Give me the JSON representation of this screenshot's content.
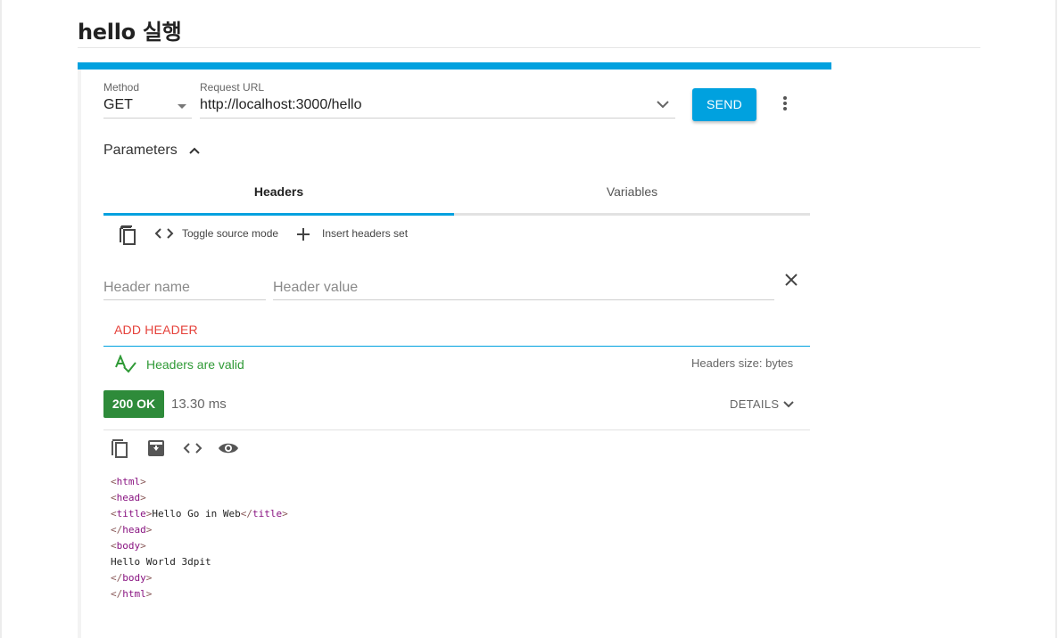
{
  "page": {
    "title": "hello 실행"
  },
  "request": {
    "method_label": "Method",
    "method_value": "GET",
    "url_label": "Request URL",
    "url_value": "http://localhost:3000/hello",
    "send_label": "SEND"
  },
  "parameters": {
    "label": "Parameters",
    "tabs": [
      {
        "label": "Headers",
        "active": true
      },
      {
        "label": "Variables",
        "active": false
      }
    ],
    "toolbar": {
      "toggle_source_label": "Toggle source mode",
      "insert_set_label": "Insert headers set"
    },
    "header_row": {
      "name_placeholder": "Header name",
      "value_placeholder": "Header value"
    },
    "add_header_label": "ADD HEADER",
    "validation": {
      "valid_text": "Headers are valid",
      "size_text": "Headers size: bytes"
    }
  },
  "response": {
    "status": "200 OK",
    "time": "13.30 ms",
    "details_label": "DETAILS",
    "status_color": "#2e8b3a",
    "body_lines": [
      {
        "open": "<",
        "tag": "html",
        "close": ">",
        "text": ""
      },
      {
        "open": "<",
        "tag": "head",
        "close": ">",
        "text": ""
      },
      {
        "open": "<",
        "tag": "title",
        "close": ">",
        "text": "Hello Go in Web",
        "end_open": "</",
        "end_tag": "title",
        "end_close": ">"
      },
      {
        "open": "</",
        "tag": "head",
        "close": ">",
        "text": ""
      },
      {
        "open": "<",
        "tag": "body",
        "close": ">",
        "text": ""
      },
      {
        "open": "",
        "tag": "",
        "close": "",
        "text": "Hello World 3dpit"
      },
      {
        "open": "</",
        "tag": "body",
        "close": ">",
        "text": ""
      },
      {
        "open": "</",
        "tag": "html",
        "close": ">",
        "text": ""
      }
    ]
  },
  "colors": {
    "accent": "#00a1df",
    "valid": "#2f9a36",
    "add_header": "#e5413a"
  },
  "icons": {
    "method_dropdown": "caret-down-icon",
    "url_dropdown": "chevron-down-icon",
    "menu": "more-vert-icon",
    "params_toggle": "chevron-up-icon",
    "copy": "copy-icon",
    "source": "code-icon",
    "insert": "plus-icon",
    "remove": "close-icon",
    "valid": "spellcheck-icon",
    "details": "chevron-down-icon",
    "response_copy": "copy-icon",
    "response_save": "archive-icon",
    "response_source": "code-icon",
    "response_preview": "eye-icon"
  }
}
